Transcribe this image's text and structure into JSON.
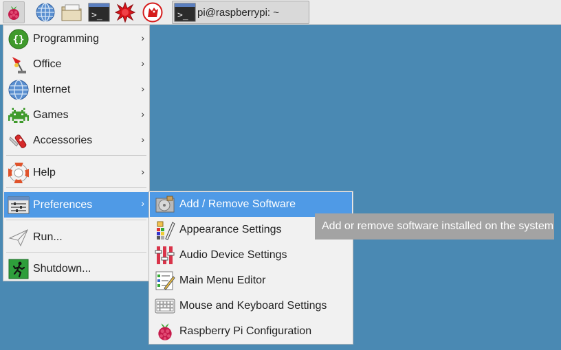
{
  "taskbar": {
    "launchers": [
      {
        "icon": "raspberry-menu-icon"
      },
      {
        "icon": "web-browser-icon"
      },
      {
        "icon": "file-manager-icon"
      },
      {
        "icon": "terminal-icon"
      },
      {
        "icon": "mathematica-icon"
      },
      {
        "icon": "wolfram-icon"
      }
    ],
    "window": {
      "title": "pi@raspberrypi: ~",
      "icon": "terminal-icon"
    }
  },
  "main_menu": {
    "items": [
      {
        "label": "Programming",
        "icon": "programming-icon",
        "submenu": true
      },
      {
        "label": "Office",
        "icon": "office-icon",
        "submenu": true
      },
      {
        "label": "Internet",
        "icon": "internet-globe-icon",
        "submenu": true
      },
      {
        "label": "Games",
        "icon": "games-invader-icon",
        "submenu": true
      },
      {
        "label": "Accessories",
        "icon": "accessories-knife-icon",
        "submenu": true
      },
      {
        "label": "Help",
        "icon": "help-lifebuoy-icon",
        "submenu": true
      },
      {
        "label": "Preferences",
        "icon": "preferences-icon",
        "submenu": true
      },
      {
        "label": "Run...",
        "icon": "run-paperplane-icon",
        "submenu": false
      },
      {
        "label": "Shutdown...",
        "icon": "shutdown-exit-icon",
        "submenu": false
      }
    ],
    "arrow": "›"
  },
  "sub_menu": {
    "items": [
      {
        "label": "Add / Remove Software",
        "icon": "add-remove-software-icon"
      },
      {
        "label": "Appearance Settings",
        "icon": "appearance-settings-icon"
      },
      {
        "label": "Audio Device Settings",
        "icon": "audio-settings-icon"
      },
      {
        "label": "Main Menu Editor",
        "icon": "menu-editor-icon"
      },
      {
        "label": "Mouse and Keyboard Settings",
        "icon": "keyboard-icon"
      },
      {
        "label": "Raspberry Pi Configuration",
        "icon": "raspberry-config-icon"
      }
    ]
  },
  "tooltip": {
    "text": "Add or remove software installed on the system"
  },
  "colors": {
    "desktop": "#4a89b3",
    "highlight": "#4f9ae6",
    "menu_bg": "#f1f1f1",
    "tooltip_bg": "#a3a3a3"
  }
}
